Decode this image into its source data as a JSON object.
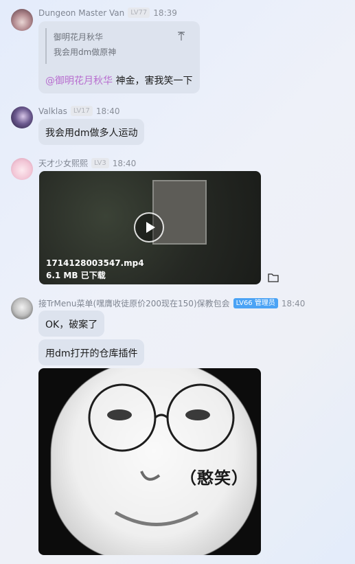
{
  "messages": [
    {
      "sender": "Dungeon Master Van",
      "level": "LV77",
      "time": "18:39",
      "quote_author": "御明花月秋华",
      "quote_text": "我会用dm做原神",
      "mention": "@御明花月秋华",
      "text": "神金，害我笑一下"
    },
    {
      "sender": "Valklas",
      "level": "LV17",
      "time": "18:40",
      "text": "我会用dm做多人运动"
    },
    {
      "sender": "天才少女熙熙",
      "level": "LV3",
      "time": "18:40",
      "video_filename": "1714128003547.mp4",
      "video_status": "6.1 MB 已下载"
    },
    {
      "sender": "接TrMenu菜单(嘿膺收徒原价200现在150)保教包会",
      "level": "LV66 管理员",
      "time": "18:40",
      "texts": [
        "OK，破案了",
        "用dm打开的仓库插件"
      ],
      "meme_caption": "（憨笑）"
    }
  ],
  "colors": {
    "bubble": "#dde3ee",
    "mention": "#b86dcf",
    "admin_badge": "#4ba3f5"
  }
}
